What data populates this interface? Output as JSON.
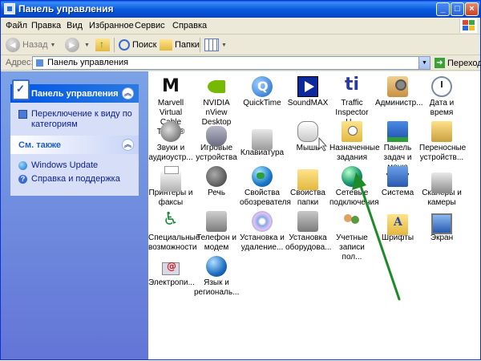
{
  "window": {
    "title": "Панель управления"
  },
  "menu": {
    "items": [
      "Файл",
      "Правка",
      "Вид",
      "Избранное",
      "Сервис",
      "Справка"
    ]
  },
  "toolbar": {
    "back_label": "Назад",
    "search_label": "Поиск",
    "folders_label": "Папки"
  },
  "address": {
    "label": "Адрес:",
    "value": "Панель управления",
    "go_label": "Переход"
  },
  "sidebar": {
    "panel_title": "Панель управления",
    "switch_view": "Переключение к виду по категориям",
    "see_also_title": "См. также",
    "see_also_items": [
      "Windows Update",
      "Справка и поддержка"
    ]
  },
  "items": [
    {
      "label": "Marvell Virtual Cable Tester®",
      "icon": "marvell-icon"
    },
    {
      "label": "NVIDIA nView Desktop M...",
      "icon": "nvidia-icon"
    },
    {
      "label": "QuickTime",
      "icon": "quicktime-icon"
    },
    {
      "label": "SoundMAX",
      "icon": "soundmax-icon"
    },
    {
      "label": "Traffic Inspector U...",
      "icon": "traffic-inspector-icon"
    },
    {
      "label": "Администр...",
      "icon": "administration-icon"
    },
    {
      "label": "Дата и время",
      "icon": "clock-icon"
    },
    {
      "label": "Звуки и аудиоустр...",
      "icon": "speaker-icon"
    },
    {
      "label": "Игровые устройства",
      "icon": "gamepad-icon"
    },
    {
      "label": "Клавиатура",
      "icon": "keyboard-icon"
    },
    {
      "label": "Мышь",
      "icon": "mouse-icon"
    },
    {
      "label": "Назначенные задания",
      "icon": "scheduled-tasks-icon"
    },
    {
      "label": "Панель задач и меню \"Пуск\"",
      "icon": "taskbar-icon"
    },
    {
      "label": "Переносные устройств...",
      "icon": "portable-devices-icon"
    },
    {
      "label": "Принтеры и факсы",
      "icon": "printer-icon"
    },
    {
      "label": "Речь",
      "icon": "speech-icon"
    },
    {
      "label": "Свойства обозревателя",
      "icon": "internet-options-icon"
    },
    {
      "label": "Свойства папки",
      "icon": "folder-options-icon"
    },
    {
      "label": "Сетевые подключения",
      "icon": "network-connections-icon"
    },
    {
      "label": "Система",
      "icon": "system-icon"
    },
    {
      "label": "Сканеры и камеры",
      "icon": "scanner-icon"
    },
    {
      "label": "Специальные возможности",
      "icon": "accessibility-icon"
    },
    {
      "label": "Телефон и модем",
      "icon": "phone-modem-icon"
    },
    {
      "label": "Установка и удаление...",
      "icon": "add-remove-programs-icon"
    },
    {
      "label": "Установка оборудова...",
      "icon": "add-hardware-icon"
    },
    {
      "label": "Учетные записи пол...",
      "icon": "user-accounts-icon"
    },
    {
      "label": "Шрифты",
      "icon": "fonts-icon"
    },
    {
      "label": "Экран",
      "icon": "display-icon"
    },
    {
      "label": "Электропи...",
      "icon": "power-options-icon"
    },
    {
      "label": "Язык и региональ...",
      "icon": "regional-options-icon"
    }
  ],
  "annotation_arrow_color": "#1e8a28"
}
